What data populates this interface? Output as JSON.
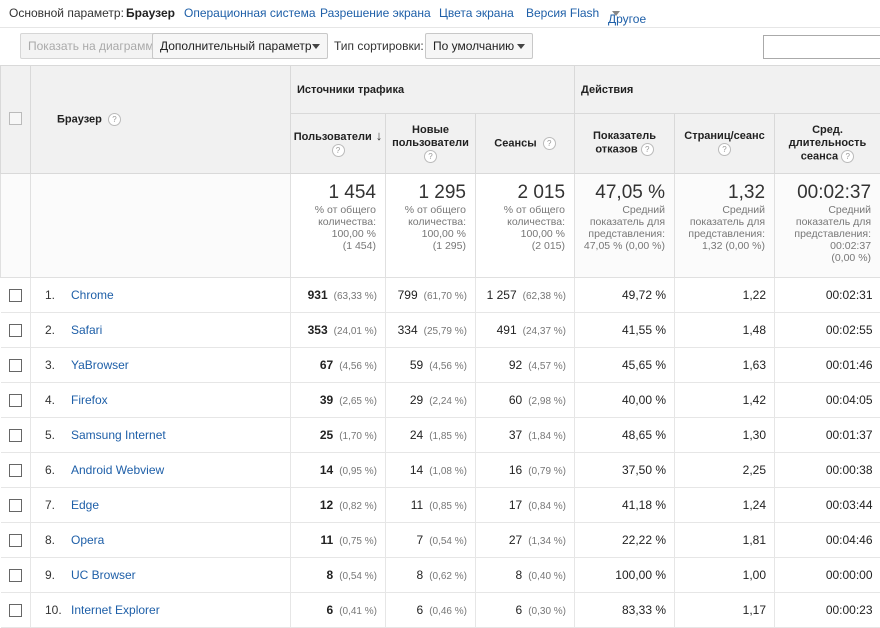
{
  "dimensions": {
    "label": "Основной параметр:",
    "selected": "Браузер",
    "links": [
      "Операционная система",
      "Разрешение экрана",
      "Цвета экрана",
      "Версия Flash"
    ],
    "other": "Другое"
  },
  "toolbar": {
    "chart_button": "Показать на диаграмме",
    "secondary_dim": "Дополнительный параметр",
    "sort_label": "Тип сортировки:",
    "sort_value": "По умолчанию"
  },
  "header": {
    "browser": "Браузер",
    "group_traffic": "Источники трафика",
    "group_actions": "Действия",
    "metrics": [
      "Пользователи",
      "Новые пользователи",
      "Сеансы",
      "Показатель отказов",
      "Страниц/сеанс",
      "Сред. длительность сеанса"
    ],
    "help_mark": "?",
    "sort_arrow": "↓"
  },
  "totals": [
    {
      "value": "1 454",
      "l1": "% от общего",
      "l2": "количества:",
      "l3": "100,00 %",
      "l4": "(1 454)"
    },
    {
      "value": "1 295",
      "l1": "% от общего",
      "l2": "количества:",
      "l3": "100,00 %",
      "l4": "(1 295)"
    },
    {
      "value": "2 015",
      "l1": "% от общего",
      "l2": "количества:",
      "l3": "100,00 %",
      "l4": "(2 015)"
    },
    {
      "value": "47,05 %",
      "l1": "Средний",
      "l2": "показатель для",
      "l3": "представления:",
      "l4": "47,05 % (0,00 %)"
    },
    {
      "value": "1,32",
      "l1": "Средний",
      "l2": "показатель для",
      "l3": "представления:",
      "l4": "1,32 (0,00 %)"
    },
    {
      "value": "00:02:37",
      "l1": "Средний",
      "l2": "показатель для",
      "l3": "представления:",
      "l4": "00:02:37",
      "l5": "(0,00 %)"
    }
  ],
  "rows": [
    {
      "n": "1.",
      "name": "Chrome",
      "users": "931",
      "users_p": "(63,33 %)",
      "new": "799",
      "new_p": "(61,70 %)",
      "sess": "1 257",
      "sess_p": "(62,38 %)",
      "bounce": "49,72 %",
      "pps": "1,22",
      "dur": "00:02:31"
    },
    {
      "n": "2.",
      "name": "Safari",
      "users": "353",
      "users_p": "(24,01 %)",
      "new": "334",
      "new_p": "(25,79 %)",
      "sess": "491",
      "sess_p": "(24,37 %)",
      "bounce": "41,55 %",
      "pps": "1,48",
      "dur": "00:02:55"
    },
    {
      "n": "3.",
      "name": "YaBrowser",
      "users": "67",
      "users_p": "(4,56 %)",
      "new": "59",
      "new_p": "(4,56 %)",
      "sess": "92",
      "sess_p": "(4,57 %)",
      "bounce": "45,65 %",
      "pps": "1,63",
      "dur": "00:01:46"
    },
    {
      "n": "4.",
      "name": "Firefox",
      "users": "39",
      "users_p": "(2,65 %)",
      "new": "29",
      "new_p": "(2,24 %)",
      "sess": "60",
      "sess_p": "(2,98 %)",
      "bounce": "40,00 %",
      "pps": "1,42",
      "dur": "00:04:05"
    },
    {
      "n": "5.",
      "name": "Samsung Internet",
      "users": "25",
      "users_p": "(1,70 %)",
      "new": "24",
      "new_p": "(1,85 %)",
      "sess": "37",
      "sess_p": "(1,84 %)",
      "bounce": "48,65 %",
      "pps": "1,30",
      "dur": "00:01:37"
    },
    {
      "n": "6.",
      "name": "Android Webview",
      "users": "14",
      "users_p": "(0,95 %)",
      "new": "14",
      "new_p": "(1,08 %)",
      "sess": "16",
      "sess_p": "(0,79 %)",
      "bounce": "37,50 %",
      "pps": "2,25",
      "dur": "00:00:38"
    },
    {
      "n": "7.",
      "name": "Edge",
      "users": "12",
      "users_p": "(0,82 %)",
      "new": "11",
      "new_p": "(0,85 %)",
      "sess": "17",
      "sess_p": "(0,84 %)",
      "bounce": "41,18 %",
      "pps": "1,24",
      "dur": "00:03:44"
    },
    {
      "n": "8.",
      "name": "Opera",
      "users": "11",
      "users_p": "(0,75 %)",
      "new": "7",
      "new_p": "(0,54 %)",
      "sess": "27",
      "sess_p": "(1,34 %)",
      "bounce": "22,22 %",
      "pps": "1,81",
      "dur": "00:04:46"
    },
    {
      "n": "9.",
      "name": "UC Browser",
      "users": "8",
      "users_p": "(0,54 %)",
      "new": "8",
      "new_p": "(0,62 %)",
      "sess": "8",
      "sess_p": "(0,40 %)",
      "bounce": "100,00 %",
      "pps": "1,00",
      "dur": "00:00:00"
    },
    {
      "n": "10.",
      "name": "Internet Explorer",
      "users": "6",
      "users_p": "(0,41 %)",
      "new": "6",
      "new_p": "(0,46 %)",
      "sess": "6",
      "sess_p": "(0,30 %)",
      "bounce": "83,33 %",
      "pps": "1,17",
      "dur": "00:00:23"
    }
  ]
}
